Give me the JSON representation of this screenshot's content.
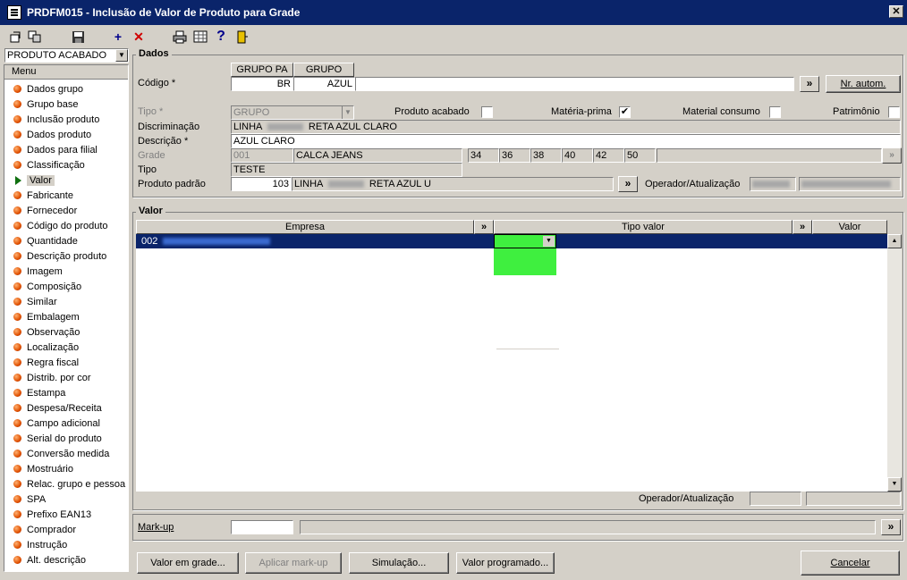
{
  "window": {
    "title": "PRDFM015 - Inclusão de Valor de Produto para Grade"
  },
  "toolbar": {
    "icons": [
      "select-icon",
      "copy-icon",
      "save-icon",
      "add-icon",
      "delete-icon",
      "print-icon",
      "grid-icon",
      "help-icon",
      "exit-icon"
    ]
  },
  "type_selector": {
    "value": "PRODUTO ACABADO"
  },
  "menu": {
    "header": "Menu",
    "items": [
      "Dados grupo",
      "Grupo base",
      "Inclusão produto",
      "Dados produto",
      "Dados para filial",
      "Classificação",
      "Valor",
      "Fabricante",
      "Fornecedor",
      "Código do produto",
      "Quantidade",
      "Descrição produto",
      "Imagem",
      "Composição",
      "Similar",
      "Embalagem",
      "Observação",
      "Localização",
      "Regra fiscal",
      "Distrib. por cor",
      "Estampa",
      "Despesa/Receita",
      "Campo adicional",
      "Serial do produto",
      "Conversão medida",
      "Mostruário",
      "Relac. grupo e pessoa",
      "SPA",
      "Prefixo EAN13",
      "Comprador",
      "Instrução",
      "Alt. descrição"
    ],
    "active_index": 6
  },
  "dados": {
    "title": "Dados",
    "codigo_label": "Código *",
    "col1_header": "GRUPO PA",
    "col2_header": "GRUPO",
    "col1_value": "BR",
    "col2_value": "AZUL",
    "more_button": "»",
    "nr_autom_button": "Nr. autom.",
    "tipo_label": "Tipo *",
    "tipo_value": "GRUPO",
    "produto_acabado_label": "Produto acabado",
    "produto_acabado_checked": false,
    "materia_prima_label": "Matéria-prima",
    "materia_prima_checked": true,
    "material_consumo_label": "Material consumo",
    "material_consumo_checked": false,
    "patrimonio_label": "Patrimônio",
    "patrimonio_checked": false,
    "discriminacao_label": "Discriminação",
    "discriminacao_value_a": "LINHA",
    "discriminacao_value_b": "RETA AZUL CLARO",
    "descricao_label": "Descrição *",
    "descricao_value": "AZUL CLARO",
    "grade_label": "Grade",
    "grade_code": "001",
    "grade_name": "CALCA JEANS",
    "sizes": [
      "34",
      "36",
      "38",
      "40",
      "42",
      "50"
    ],
    "tipo2_label": "Tipo",
    "tipo2_value": "TESTE",
    "produto_padrao_label": "Produto padrão",
    "produto_padrao_code": "103",
    "produto_padrao_desc_a": "LINHA",
    "produto_padrao_desc_b": "RETA AZUL U",
    "operador_label": "Operador/Atualização"
  },
  "valor": {
    "title": "Valor",
    "col_empresa": "Empresa",
    "col_tipo_valor": "Tipo valor",
    "col_valor": "Valor",
    "expand": "»",
    "rows": [
      {
        "code": "002"
      }
    ],
    "operador_label": "Operador/Atualização"
  },
  "markup": {
    "label": "Mark-up",
    "more_button": "»"
  },
  "buttons": {
    "valor_em_grade": "Valor em grade...",
    "aplicar_markup": "Aplicar mark-up",
    "simulacao": "Simulação...",
    "valor_programado": "Valor programado...",
    "cancelar": "Cancelar"
  },
  "colors": {
    "titlebar": "#0a246a",
    "selection": "#0a246a",
    "dropdown": "#3fef3f",
    "face": "#d4d0c8"
  }
}
